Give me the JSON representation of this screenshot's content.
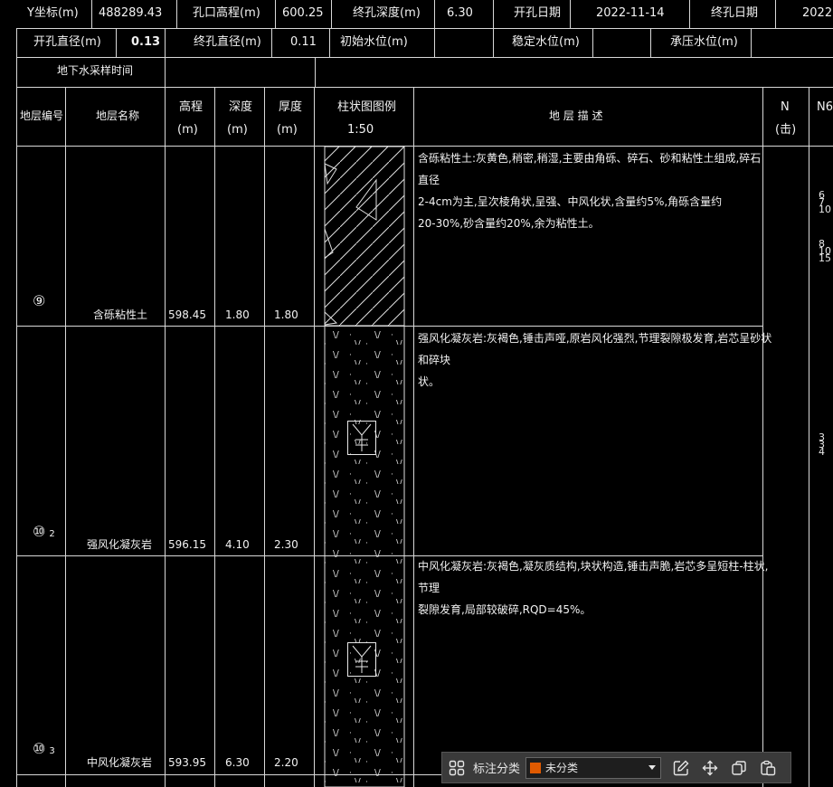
{
  "header": {
    "row1": [
      {
        "label": "Y坐标(m)",
        "value": "488289.43"
      },
      {
        "label": "孔口高程(m)",
        "value": "600.25"
      },
      {
        "label": "终孔深度(m)",
        "value": "6.30"
      },
      {
        "label": "开孔日期",
        "value": "2022-11-14"
      },
      {
        "label": "终孔日期",
        "value": "2022"
      }
    ],
    "row2": [
      {
        "label": "开孔直径(m)",
        "value": "0.13"
      },
      {
        "label": "终孔直径(m)",
        "value": "0.11"
      },
      {
        "label": "初始水位(m)",
        "value": ""
      },
      {
        "label": "稳定水位(m)",
        "value": ""
      },
      {
        "label": "承压水位(m)",
        "value": ""
      }
    ],
    "groundwater_time": "地下水采样时间"
  },
  "columns": {
    "layer_no": "地层编号",
    "layer_name": "地层名称",
    "elevation": "高程",
    "depth": "深度",
    "thickness": "厚度",
    "unit_m": "(m)",
    "column_legend": "柱状图图例",
    "scale": "1:50",
    "description": "地  层  描  述",
    "n": "N",
    "n_unit": "(击)",
    "n63": "N6"
  },
  "layers": [
    {
      "no": "⑨",
      "sub": "",
      "name": "含砾粘性土",
      "elevation": "598.45",
      "depth": "1.80",
      "thickness": "1.80",
      "desc_lines": [
        "含砾粘性土:灰黄色,稍密,稍湿,主要由角砾、碎石、砂和粘性土组成,碎石直径",
        "2-4cm为主,呈次棱角状,呈强、中风化状,含量约5%,角砾含量约",
        "20-30%,砂含量约20%,余为粘性土。"
      ]
    },
    {
      "no": "⑩",
      "sub": "2",
      "name": "强风化凝灰岩",
      "elevation": "596.15",
      "depth": "4.10",
      "thickness": "2.30",
      "desc_lines": [
        "强风化凝灰岩:灰褐色,锤击声哑,原岩风化强烈,节理裂隙极发育,岩芯呈砂状和碎块",
        "状。"
      ]
    },
    {
      "no": "⑩",
      "sub": "3",
      "name": "中风化凝灰岩",
      "elevation": "593.95",
      "depth": "6.30",
      "thickness": "2.20",
      "desc_lines": [
        "中风化凝灰岩:灰褐色,凝灰质结构,块状构造,锤击声脆,岩芯多呈短柱-柱状,节理",
        "裂隙发育,局部较破碎,RQD=45%。"
      ]
    }
  ],
  "n63_marks": [
    {
      "lines": [
        "6",
        "7",
        "10"
      ]
    },
    {
      "lines": [
        "8",
        "10",
        "15"
      ]
    },
    {
      "lines": [
        "3",
        "3",
        "4"
      ]
    }
  ],
  "toolbar": {
    "group_icon": "group-icon",
    "label": "标注分类",
    "selected": "未分类",
    "selected_color": "#e05a00",
    "edit_icon": "edit-icon",
    "move_icon": "move-icon",
    "copy_icon": "copy-icon",
    "paste_icon": "paste-icon"
  }
}
